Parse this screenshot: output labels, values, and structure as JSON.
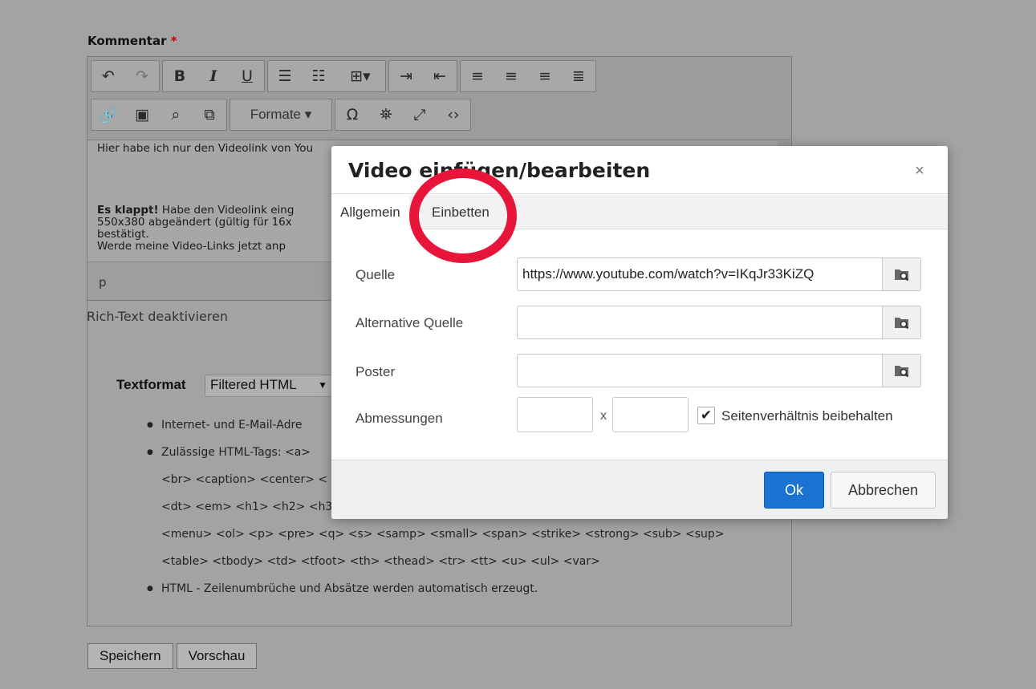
{
  "form": {
    "comment_label": "Kommentar",
    "required_mark": "*",
    "rich_text_toggle": "Rich-Text deaktivieren",
    "save_button": "Speichern",
    "preview_button": "Vorschau"
  },
  "toolbar": {
    "undo": "↶",
    "redo": "↷",
    "bold": "B",
    "italic": "I",
    "underline": "U",
    "bullet_list": "☰",
    "numbered_list": "☷",
    "table": "⊞▾",
    "indent": "⇥",
    "outdent": "⇤",
    "align_left": "≡",
    "align_center": "≡",
    "align_right": "≡",
    "align_justify": "≣",
    "link": "🔗",
    "image": "▣",
    "media_browse": "⌕",
    "media": "⧉",
    "formats": "Formate ▾",
    "special_char": "Ω",
    "find": "⛯",
    "fullscreen": "⤢",
    "source": "‹›"
  },
  "content": {
    "line1": "Hier habe ich nur den Videolink von You",
    "para2_bold": "Es klappt!",
    "para2_line1": " Habe den Videolink eing",
    "para2_line2": "550x380 abgeändert (gültig für 16x",
    "para2_line3": "bestätigt.",
    "para2_line4": "Werde meine Video-Links jetzt anp"
  },
  "statusbar": {
    "path": "p"
  },
  "text_format": {
    "label": "Textformat",
    "selected": "Filtered HTML",
    "tips": [
      "Internet- und E-Mail-Adre",
      "Zulässige HTML-Tags: <a>",
      "<br> <caption> <center> <",
      "<dt> <em> <h1> <h2> <h3",
      "<menu> <ol> <p> <pre> <q> <s> <samp> <small> <span> <strike> <strong> <sub> <sup>",
      "<table> <tbody> <td> <tfoot> <th> <thead> <tr> <tt> <u> <ul> <var>",
      "HTML - Zeilenumbrüche und Absätze werden automatisch erzeugt."
    ]
  },
  "dialog": {
    "title": "Video einfügen/bearbeiten",
    "close": "×",
    "tabs": [
      "Allgemein",
      "Einbetten"
    ],
    "fields": {
      "source_label": "Quelle",
      "source_value": "https://www.youtube.com/watch?v=IKqJr33KiZQ",
      "alt_source_label": "Alternative Quelle",
      "alt_source_value": "",
      "poster_label": "Poster",
      "poster_value": "",
      "dimensions_label": "Abmessungen",
      "width_value": "",
      "height_value": "",
      "dimension_separator": "x",
      "constrain_label": "Seitenverhältnis beibehalten",
      "constrain_checked": true
    },
    "ok": "Ok",
    "cancel": "Abbrechen"
  }
}
